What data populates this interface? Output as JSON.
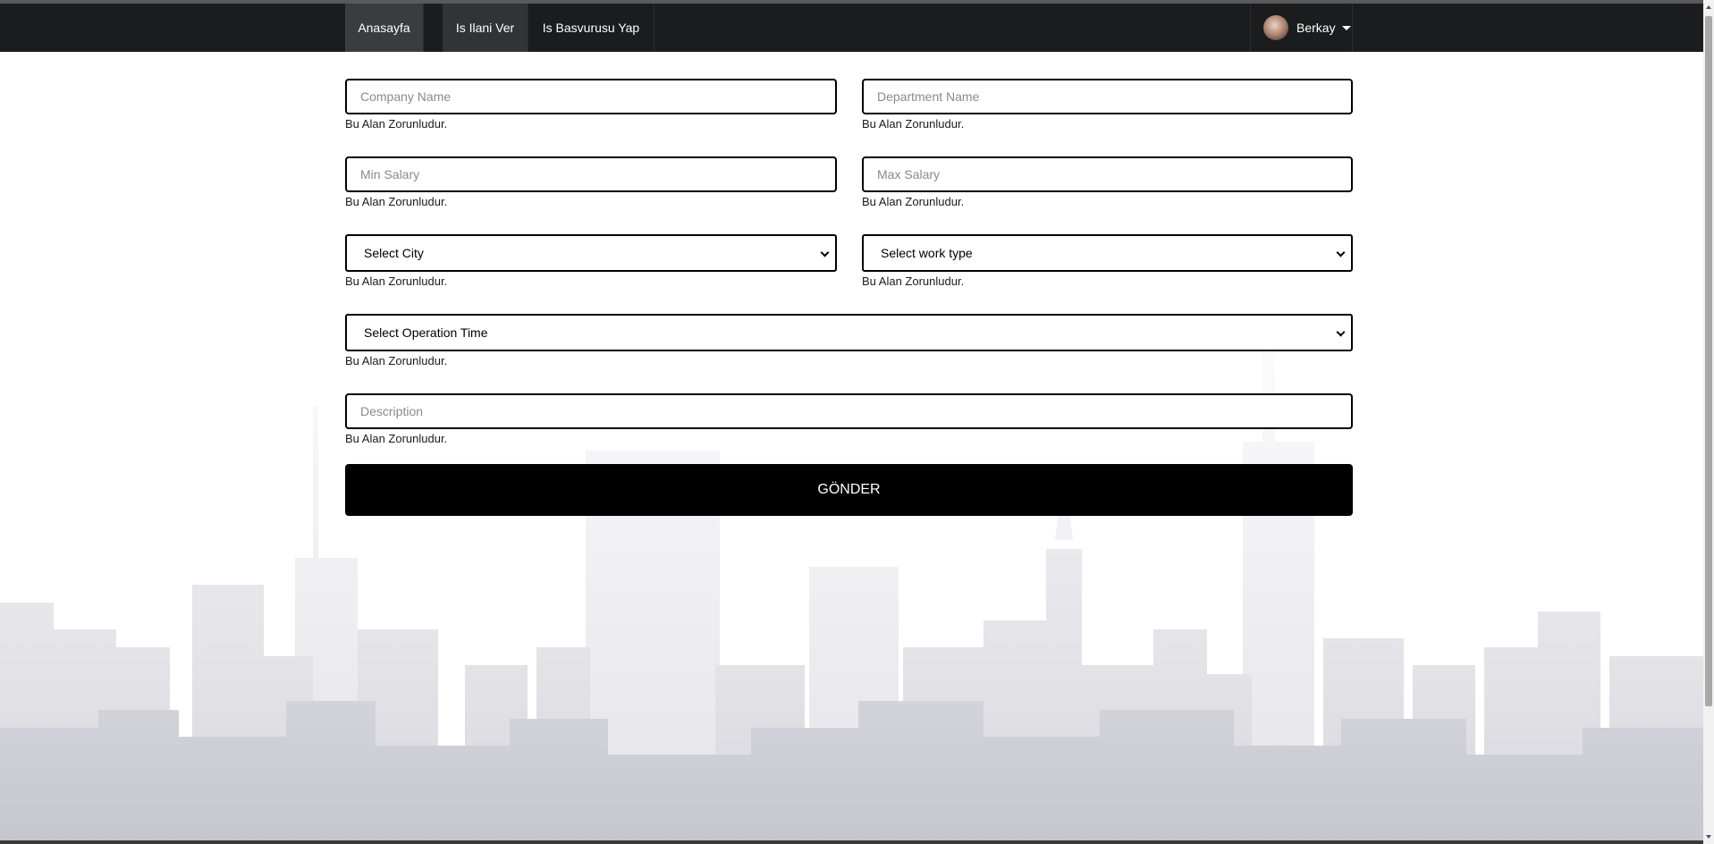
{
  "nav": {
    "items": [
      {
        "label": "Anasayfa"
      },
      {
        "label": "Is Ilani Ver"
      },
      {
        "label": "Is Basvurusu Yap"
      }
    ],
    "user": {
      "name": "Berkay"
    }
  },
  "form": {
    "company_name": {
      "placeholder": "Company Name"
    },
    "department_name": {
      "placeholder": "Department Name"
    },
    "min_salary": {
      "placeholder": "Min Salary"
    },
    "max_salary": {
      "placeholder": "Max Salary"
    },
    "city": {
      "selected": "Select City"
    },
    "work_type": {
      "selected": "Select work type"
    },
    "operation_time": {
      "selected": "Select Operation Time"
    },
    "description": {
      "placeholder": "Description"
    },
    "required_message": "Bu Alan Zorunludur.",
    "submit_label": "GÖNDER"
  },
  "colors": {
    "navbar": "#1b1c1d",
    "nav_active": "#3b3c3d",
    "button": "#000000"
  }
}
